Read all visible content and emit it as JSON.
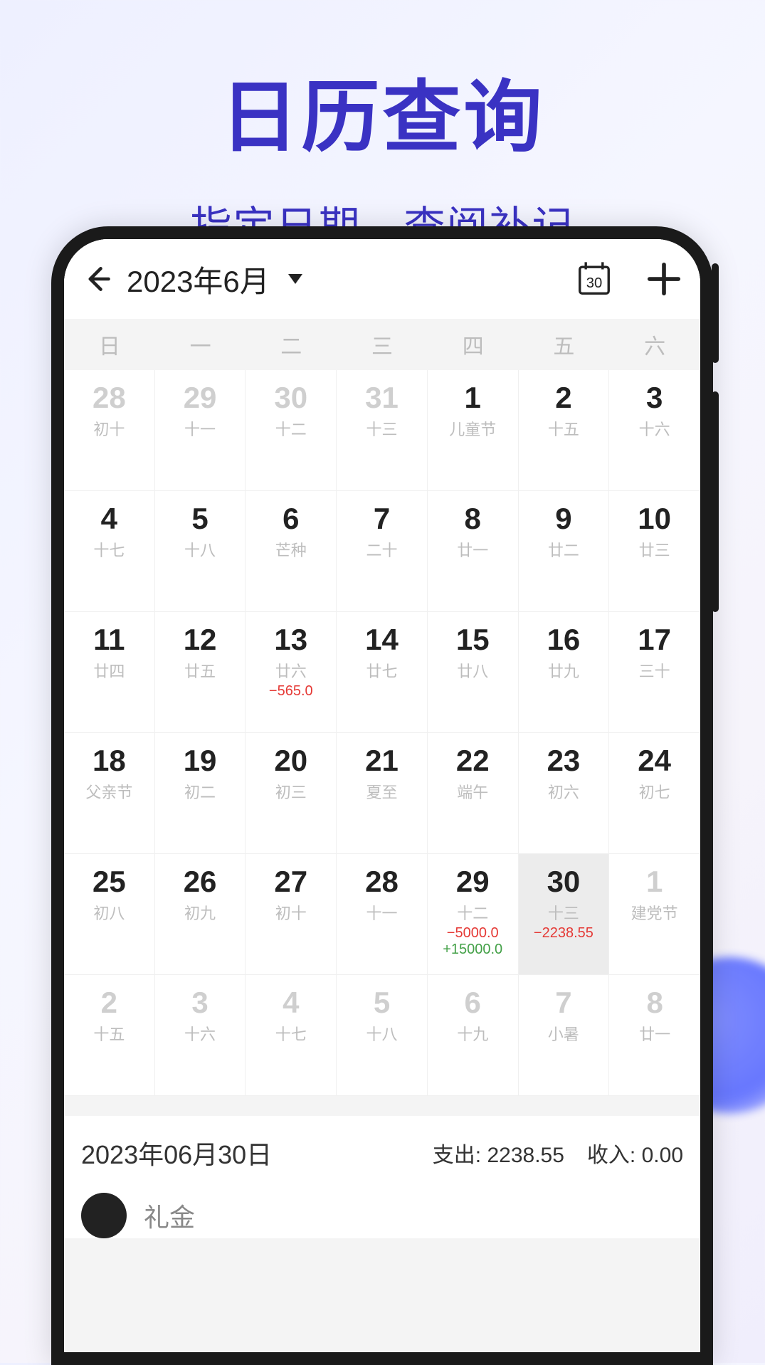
{
  "promo": {
    "title": "日历查询",
    "subtitle": "指定日期，查阅补记"
  },
  "header": {
    "month_label": "2023年6月",
    "today_icon_day": "30"
  },
  "weekdays": [
    "日",
    "一",
    "二",
    "三",
    "四",
    "五",
    "六"
  ],
  "days": [
    {
      "n": "28",
      "lunar": "初十",
      "dim": true
    },
    {
      "n": "29",
      "lunar": "十一",
      "dim": true
    },
    {
      "n": "30",
      "lunar": "十二",
      "dim": true
    },
    {
      "n": "31",
      "lunar": "十三",
      "dim": true
    },
    {
      "n": "1",
      "lunar": "儿童节"
    },
    {
      "n": "2",
      "lunar": "十五"
    },
    {
      "n": "3",
      "lunar": "十六"
    },
    {
      "n": "4",
      "lunar": "十七"
    },
    {
      "n": "5",
      "lunar": "十八"
    },
    {
      "n": "6",
      "lunar": "芒种"
    },
    {
      "n": "7",
      "lunar": "二十"
    },
    {
      "n": "8",
      "lunar": "廿一"
    },
    {
      "n": "9",
      "lunar": "廿二"
    },
    {
      "n": "10",
      "lunar": "廿三"
    },
    {
      "n": "11",
      "lunar": "廿四"
    },
    {
      "n": "12",
      "lunar": "廿五"
    },
    {
      "n": "13",
      "lunar": "廿六",
      "exp": "−565.0"
    },
    {
      "n": "14",
      "lunar": "廿七"
    },
    {
      "n": "15",
      "lunar": "廿八"
    },
    {
      "n": "16",
      "lunar": "廿九"
    },
    {
      "n": "17",
      "lunar": "三十"
    },
    {
      "n": "18",
      "lunar": "父亲节"
    },
    {
      "n": "19",
      "lunar": "初二"
    },
    {
      "n": "20",
      "lunar": "初三"
    },
    {
      "n": "21",
      "lunar": "夏至"
    },
    {
      "n": "22",
      "lunar": "端午"
    },
    {
      "n": "23",
      "lunar": "初六"
    },
    {
      "n": "24",
      "lunar": "初七"
    },
    {
      "n": "25",
      "lunar": "初八"
    },
    {
      "n": "26",
      "lunar": "初九"
    },
    {
      "n": "27",
      "lunar": "初十"
    },
    {
      "n": "28",
      "lunar": "十一"
    },
    {
      "n": "29",
      "lunar": "十二",
      "exp": "−5000.0",
      "inc": "+15000.0"
    },
    {
      "n": "30",
      "lunar": "十三",
      "exp": "−2238.55",
      "selected": true
    },
    {
      "n": "1",
      "lunar": "建党节",
      "dim": true
    },
    {
      "n": "2",
      "lunar": "十五",
      "dim": true
    },
    {
      "n": "3",
      "lunar": "十六",
      "dim": true
    },
    {
      "n": "4",
      "lunar": "十七",
      "dim": true
    },
    {
      "n": "5",
      "lunar": "十八",
      "dim": true
    },
    {
      "n": "6",
      "lunar": "十九",
      "dim": true
    },
    {
      "n": "7",
      "lunar": "小暑",
      "dim": true
    },
    {
      "n": "8",
      "lunar": "廿一",
      "dim": true
    }
  ],
  "summary": {
    "date": "2023年06月30日",
    "expense_label": "支出:",
    "expense_value": "2238.55",
    "income_label": "收入:",
    "income_value": "0.00"
  },
  "tx_preview": {
    "label": "礼金"
  }
}
